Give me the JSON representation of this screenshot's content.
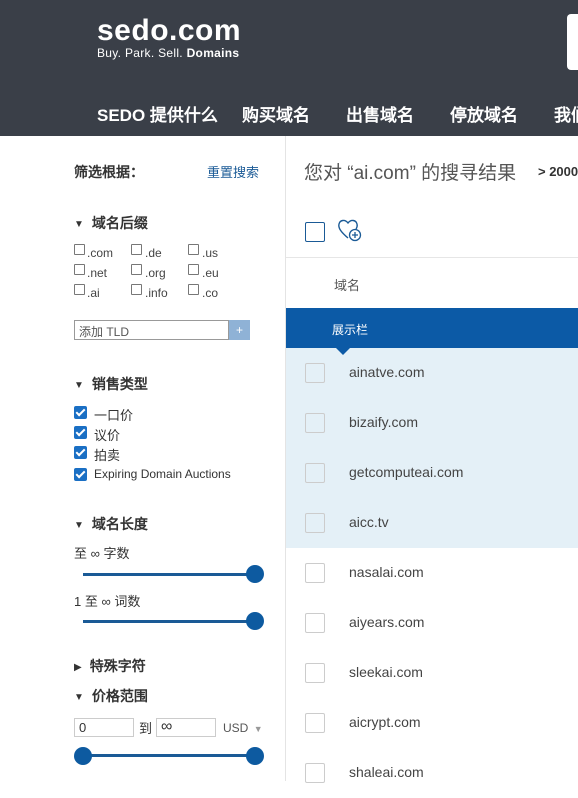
{
  "header": {
    "logo": "sedo.com",
    "tagline_prefix": "Buy. Park. Sell.",
    "tagline_bold": "Domains",
    "nav": [
      "SEDO 提供什么",
      "购买域名",
      "出售域名",
      "停放域名",
      "我们"
    ]
  },
  "sidebar": {
    "filter_title": "筛选根据：",
    "reset_label": "重置搜索",
    "tld": {
      "heading": "域名后缀",
      "options": [
        ".com",
        ".de",
        ".us",
        ".net",
        ".org",
        ".eu",
        ".ai",
        ".info",
        ".co"
      ],
      "input_placeholder": "添加 TLD",
      "add_label": "+"
    },
    "sale_type": {
      "heading": "销售类型",
      "options": [
        "一口价",
        "议价",
        "拍卖",
        "Expiring Domain Auctions"
      ]
    },
    "length": {
      "heading": "域名长度",
      "chars_label": "至 ∞ 字数",
      "words_label": "1 至 ∞ 词数"
    },
    "special": {
      "heading": "特殊字符"
    },
    "price": {
      "heading": "价格范围",
      "min": "0",
      "to_label": "到",
      "max": "∞",
      "currency": "USD"
    }
  },
  "main": {
    "results_title": "您对 “ai.com” 的搜寻结果",
    "results_count": "> 2000",
    "column_header": "域名",
    "showcase_label": "展示栏",
    "showcase_domains": [
      "ainatve.com",
      "bizaify.com",
      "getcomputeai.com",
      "aicc.tv"
    ],
    "domains": [
      "nasalai.com",
      "aiyears.com",
      "sleekai.com",
      "aicrypt.com",
      "shaleai.com"
    ]
  },
  "colors": {
    "header_bg": "#3a3f48",
    "accent": "#0c5aa6",
    "showcase_bg": "#e4f0f7"
  }
}
